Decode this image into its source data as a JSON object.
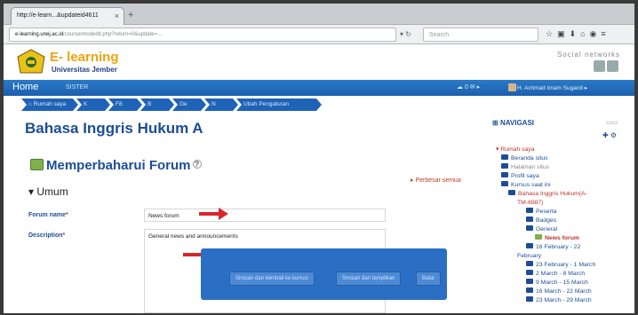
{
  "browser": {
    "tab_title": "http://e-learn...&updateid4611",
    "url_host": "e-learning.unej.ac.id",
    "url_rest": "/course/modedit.php?return=0&update=...",
    "search_placeholder": "Search"
  },
  "header": {
    "brand_title": "E- learning",
    "brand_sub": "Universitas Jember",
    "social_label": "Social networks"
  },
  "topnav": {
    "home": "Home",
    "sister": "SISTER",
    "icons_text": "☁  0 ✉ ▸",
    "user": "H. Achmad Imam Sugardi ▸"
  },
  "breadcrumb": [
    "Rumah saya",
    "K",
    "F8",
    "B",
    "Ge",
    "N",
    "Ubah Pengaturan"
  ],
  "main": {
    "course_title": "Bahasa Inggris Hukum A",
    "page_heading": "Memperbaharui Forum",
    "expand_all": "Perbesar semua",
    "section_title": "Umum",
    "fields": [
      {
        "label": "Forum name",
        "value": "News forum"
      },
      {
        "label": "Description",
        "value": "General news and announcements"
      }
    ],
    "buttons": [
      "Simpan dan kembali ke kursus",
      "Simpan dan tampilkan",
      "Batal"
    ]
  },
  "sidebar": {
    "title": "NAVIGASI",
    "items": [
      {
        "label": "Rumah saya",
        "style": "red"
      },
      {
        "label": "Beranda situs",
        "style": "normal"
      },
      {
        "label": "Halaman situs",
        "style": "grey"
      },
      {
        "label": "Profil saya",
        "style": "normal"
      },
      {
        "label": "Kursus saat ini",
        "style": "normal"
      },
      {
        "label": "Bahasa Inggris Hukum(A-",
        "style": "red"
      },
      {
        "label": "TM-6987)",
        "style": "red"
      },
      {
        "label": "Peserta",
        "style": "normal"
      },
      {
        "label": "Badges",
        "style": "normal"
      },
      {
        "label": "General",
        "style": "normal"
      },
      {
        "label": "News forum",
        "style": "bold"
      },
      {
        "label": "16 February - 22",
        "style": "normal"
      },
      {
        "label": "February",
        "style": "normal"
      },
      {
        "label": "23 February - 1 March",
        "style": "normal"
      },
      {
        "label": "2 March - 8 March",
        "style": "normal"
      },
      {
        "label": "9 March - 15 March",
        "style": "normal"
      },
      {
        "label": "16 March - 22 March",
        "style": "normal"
      },
      {
        "label": "23 March - 29 March",
        "style": "normal"
      }
    ]
  },
  "colors": {
    "brand_blue": "#1c4e96",
    "nav_blue": "#1e63b7",
    "accent_orange": "#f0a30a",
    "required_red": "#c0392b"
  }
}
